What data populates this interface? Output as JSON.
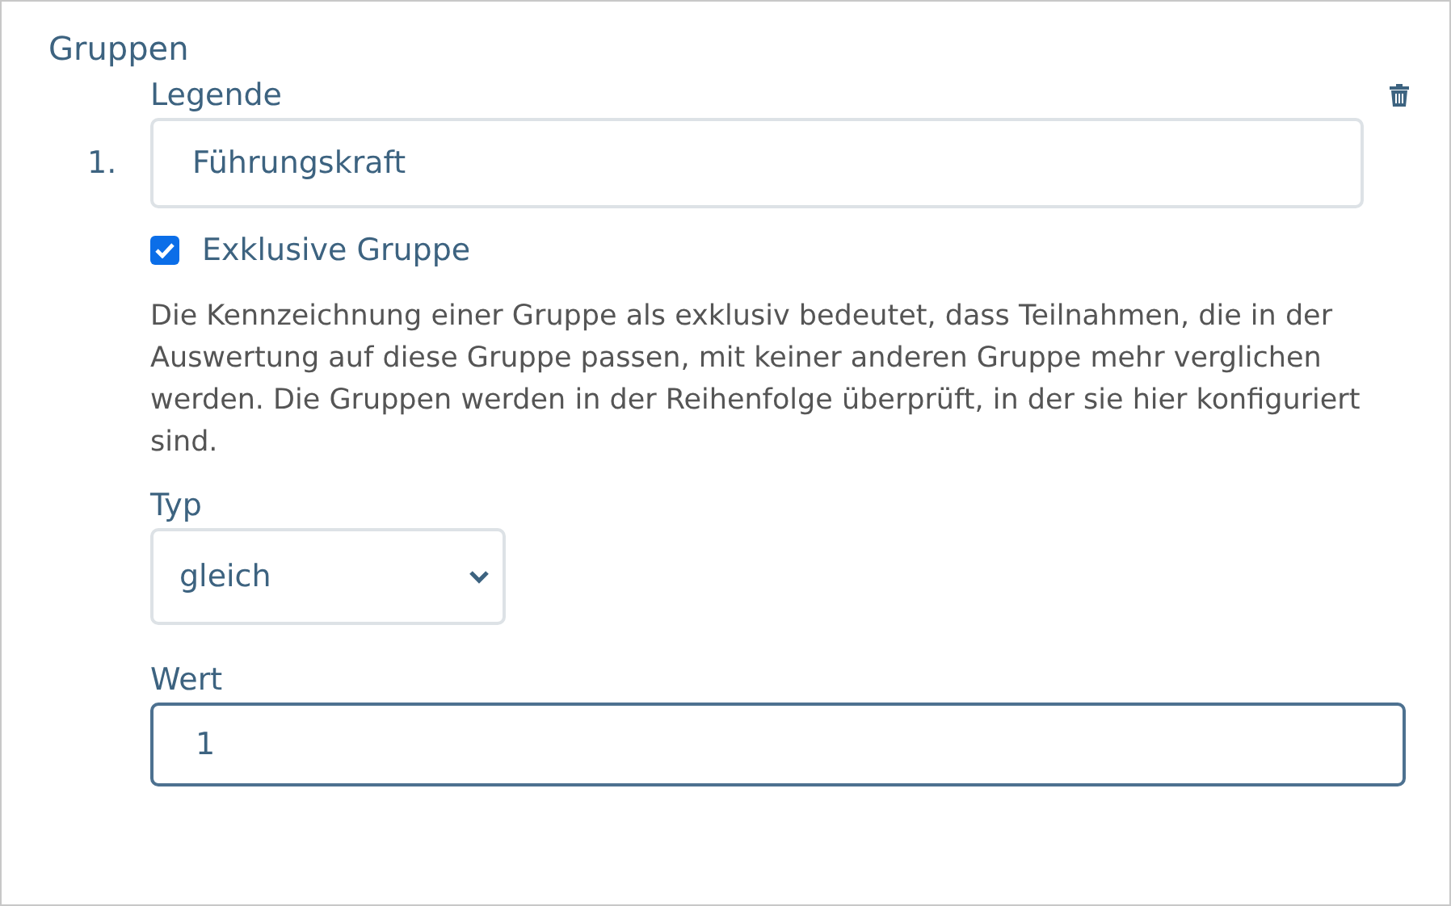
{
  "section": {
    "title": "Gruppen"
  },
  "groups": [
    {
      "number": "1.",
      "legend_label": "Legende",
      "legend_value": "Führungskraft",
      "exclusive": {
        "label": "Exklusive Gruppe",
        "checked": true
      },
      "description": "Die Kennzeichnung einer Gruppe als exklusiv bedeutet, dass Teilnahmen, die in der Auswertung auf diese Gruppe passen, mit keiner anderen Gruppe mehr verglichen werden. Die Gruppen werden in der Reihenfolge überprüft, in der sie hier konfiguriert sind.",
      "type_label": "Typ",
      "type_value": "gleich",
      "value_label": "Wert",
      "value": "1",
      "value_focused": true
    }
  ]
}
